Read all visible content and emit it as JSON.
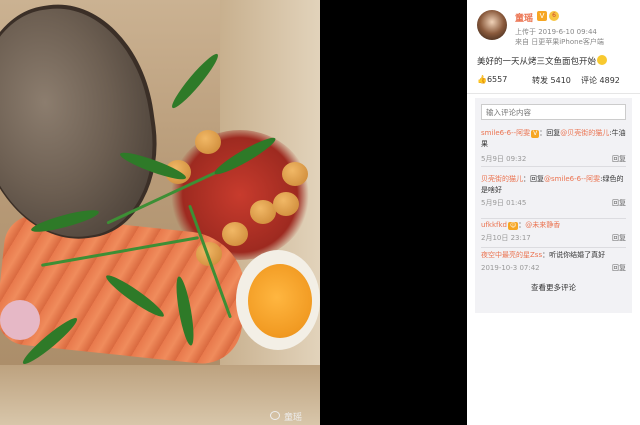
{
  "post": {
    "username": "童瑶",
    "v_badge": "V",
    "level_badge": "6",
    "upload_time": "上传于 2019-6-10 09:44",
    "source": "来自 日更苹果iPhone客户端",
    "text": "美好的一天从烤三文鱼面包开始"
  },
  "actions": {
    "likes": "6557",
    "repost": "转发 5410",
    "comments": "评论 4892"
  },
  "comment_input": {
    "placeholder": "输入评论内容"
  },
  "comments": [
    {
      "nick": "smile6-6--阿雯",
      "tag": "V",
      "reply_prefix": "：回复",
      "reply_to": "@贝壳街的猫儿",
      "text": ":牛油果",
      "time": "5月9日 09:32",
      "reply": "回复"
    },
    {
      "nick": "贝壳街的猫儿",
      "reply_prefix": "：回复",
      "reply_to": "@smile6-6--阿雯",
      "text": ":绿色的是啥好",
      "time": "5月9日 01:45",
      "reply": "回复"
    },
    {
      "nick": "ufkkfkd",
      "reply_prefix": "：",
      "reply_to": "@未来静香",
      "text": "",
      "time": "2月10日 23:17",
      "reply": "回复"
    },
    {
      "nick": "夜空中最亮的星Zss",
      "reply_prefix": "：",
      "reply_to": "",
      "text": "听说你结婚了真好",
      "time": "2019-10-3 07:42",
      "reply": "回复"
    }
  ],
  "more_comments": "查看更多评论",
  "watermark": "童瑶"
}
